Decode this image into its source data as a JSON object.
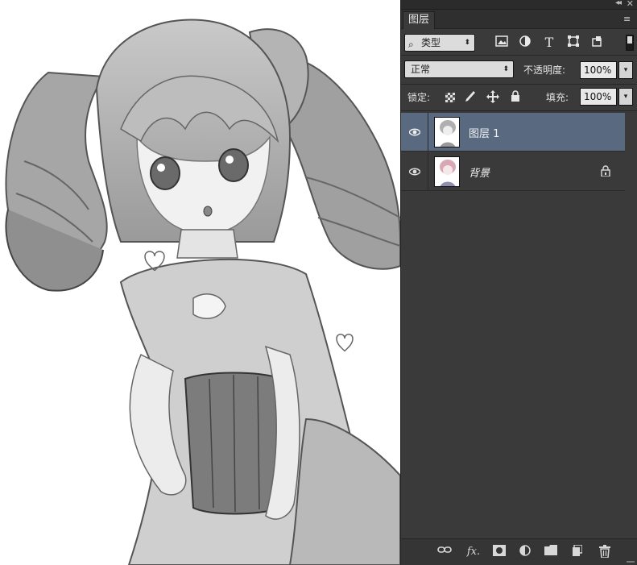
{
  "panel": {
    "tab_label": "图层",
    "collapse_glyph": "◂◂",
    "close_glyph": "✕",
    "menu_glyph": "≡"
  },
  "filter": {
    "kind_label": "类型",
    "icons": [
      "image-filter-icon",
      "adjustment-filter-icon",
      "type-filter-icon",
      "shape-filter-icon",
      "smart-object-filter-icon"
    ]
  },
  "blend": {
    "mode": "正常",
    "opacity_label": "不透明度:",
    "opacity_value": "100%"
  },
  "lock": {
    "label": "锁定:",
    "fill_label": "填充:",
    "fill_value": "100%"
  },
  "layers": [
    {
      "name": "图层 1",
      "selected": true,
      "visible": true,
      "locked": false
    },
    {
      "name": "背景",
      "selected": false,
      "visible": true,
      "locked": true
    }
  ],
  "bottom_bar": {
    "icons": [
      "link-layers-icon",
      "fx-icon",
      "layer-mask-icon",
      "adjustment-layer-icon",
      "group-folder-icon",
      "new-layer-icon",
      "delete-layer-icon"
    ],
    "fx_label": "fx."
  },
  "colors": {
    "panel_bg": "#3a3a3a",
    "selected_row": "#596a80",
    "canvas_bg": "#ffffff"
  }
}
